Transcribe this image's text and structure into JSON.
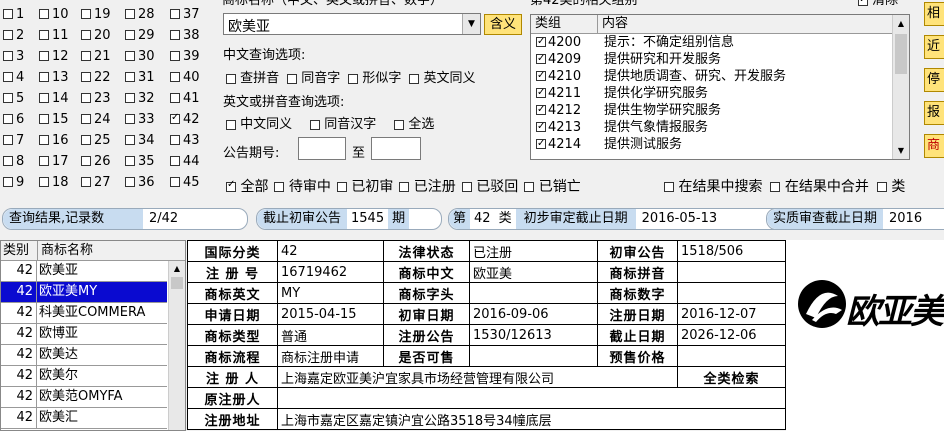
{
  "class_checks": [
    {
      "n": "1",
      "on": false
    },
    {
      "n": "10",
      "on": false
    },
    {
      "n": "19",
      "on": false
    },
    {
      "n": "28",
      "on": false
    },
    {
      "n": "37",
      "on": false
    },
    {
      "n": "2",
      "on": false
    },
    {
      "n": "11",
      "on": false
    },
    {
      "n": "20",
      "on": false
    },
    {
      "n": "29",
      "on": false
    },
    {
      "n": "38",
      "on": false
    },
    {
      "n": "3",
      "on": false
    },
    {
      "n": "12",
      "on": false
    },
    {
      "n": "21",
      "on": false
    },
    {
      "n": "30",
      "on": false
    },
    {
      "n": "39",
      "on": false
    },
    {
      "n": "4",
      "on": false
    },
    {
      "n": "13",
      "on": false
    },
    {
      "n": "22",
      "on": false
    },
    {
      "n": "31",
      "on": false
    },
    {
      "n": "40",
      "on": false
    },
    {
      "n": "5",
      "on": false
    },
    {
      "n": "14",
      "on": false
    },
    {
      "n": "23",
      "on": false
    },
    {
      "n": "32",
      "on": false
    },
    {
      "n": "41",
      "on": false
    },
    {
      "n": "6",
      "on": false
    },
    {
      "n": "15",
      "on": false
    },
    {
      "n": "24",
      "on": false
    },
    {
      "n": "33",
      "on": false
    },
    {
      "n": "42",
      "on": true
    },
    {
      "n": "7",
      "on": false
    },
    {
      "n": "16",
      "on": false
    },
    {
      "n": "25",
      "on": false
    },
    {
      "n": "34",
      "on": false
    },
    {
      "n": "43",
      "on": false
    },
    {
      "n": "8",
      "on": false
    },
    {
      "n": "17",
      "on": false
    },
    {
      "n": "26",
      "on": false
    },
    {
      "n": "35",
      "on": false
    },
    {
      "n": "44",
      "on": false
    },
    {
      "n": "9",
      "on": false
    },
    {
      "n": "18",
      "on": false
    },
    {
      "n": "27",
      "on": false
    },
    {
      "n": "36",
      "on": false
    },
    {
      "n": "45",
      "on": false
    }
  ],
  "search": {
    "title": "商标名称（中文、英文或拼音、数字）",
    "value": "欧美亚",
    "meaning_btn": "含义",
    "cn_options_title": "中文查询选项:",
    "cn_options": [
      "查拼音",
      "同音字",
      "形似字",
      "英文同义"
    ],
    "en_options_title": "英文或拼音查询选项:",
    "en_options": [
      "中文同义",
      "同音汉字",
      "全选"
    ],
    "issue_label": "公告期号:",
    "issue_to": "至"
  },
  "groups": {
    "title": "第42类的相关组别",
    "clear_label": "清除",
    "col_group": "类组",
    "col_content": "内容",
    "rows": [
      {
        "code": "4200",
        "text": "提示：不确定组别信息"
      },
      {
        "code": "4209",
        "text": "提供研究和开发服务"
      },
      {
        "code": "4210",
        "text": "提供地质调查、研究、开发服务"
      },
      {
        "code": "4211",
        "text": "提供化学研究服务"
      },
      {
        "code": "4212",
        "text": "提供生物学研究服务"
      },
      {
        "code": "4213",
        "text": "提供气象情报服务"
      },
      {
        "code": "4214",
        "text": "提供测试服务"
      }
    ]
  },
  "side_buttons": [
    "相",
    "近",
    "停",
    "报",
    "商"
  ],
  "status_filters": [
    {
      "label": "全部",
      "on": true
    },
    {
      "label": "待审中",
      "on": false
    },
    {
      "label": "已初审",
      "on": false
    },
    {
      "label": "已注册",
      "on": false
    },
    {
      "label": "已驳回",
      "on": false
    },
    {
      "label": "已销亡",
      "on": false
    }
  ],
  "result_filters": [
    "在结果中搜索",
    "在结果中合并",
    "类"
  ],
  "info_bar": {
    "result_label": "查询结果,记录数",
    "result_value": "2/42",
    "deadline_label": "截止初审公告",
    "deadline_value": "1545",
    "deadline_unit": "期",
    "class_prefix": "第",
    "class_value": "42",
    "class_suffix": "类",
    "prelim_label": "初步审定截止日期",
    "prelim_value": "2016-05-13",
    "exam_label": "实质审查截止日期",
    "exam_value": "2016"
  },
  "list": {
    "col_class": "类别",
    "col_name": "商标名称",
    "rows": [
      {
        "cls": "42",
        "name": "欧美亚",
        "sel": false
      },
      {
        "cls": "42",
        "name": "欧亚美MY",
        "sel": true
      },
      {
        "cls": "42",
        "name": "科美亚COMMERA",
        "sel": false
      },
      {
        "cls": "42",
        "name": "欧博亚",
        "sel": false
      },
      {
        "cls": "42",
        "name": "欧美达",
        "sel": false
      },
      {
        "cls": "42",
        "name": "欧美尔",
        "sel": false
      },
      {
        "cls": "42",
        "name": "欧美范OMYFA",
        "sel": false
      },
      {
        "cls": "42",
        "name": "欧美汇",
        "sel": false
      }
    ]
  },
  "detail": {
    "intl_class_label": "国际分类",
    "intl_class": "42",
    "legal_status_label": "法律状态",
    "legal_status": "已注册",
    "prelim_notice_label": "初审公告",
    "prelim_notice": "1518/506",
    "reg_no_label": "注 册 号",
    "reg_no": "16719462",
    "cn_label": "商标中文",
    "cn": "欧亚美",
    "pinyin_label": "商标拼音",
    "pinyin": "",
    "en_label": "商标英文",
    "en": "MY",
    "initial_label": "商标字头",
    "initial": "",
    "digit_label": "商标数字",
    "digit": "",
    "apply_date_label": "申请日期",
    "apply_date": "2015-04-15",
    "prelim_date_label": "初审日期",
    "prelim_date": "2016-09-06",
    "reg_date_label": "注册日期",
    "reg_date": "2016-12-07",
    "type_label": "商标类型",
    "type": "普通",
    "reg_notice_label": "注册公告",
    "reg_notice": "1530/12613",
    "expire_label": "截止日期",
    "expire": "2026-12-06",
    "flow_label": "商标流程",
    "flow": "商标注册申请",
    "for_sale_label": "是否可售",
    "for_sale": "",
    "presale_label": "预售价格",
    "presale": "",
    "registrant_label": "注 册 人",
    "registrant": "上海嘉定欧亚美沪宜家具市场经营管理有限公司",
    "full_search": "全类检索",
    "orig_registrant_label": "原注册人",
    "orig_registrant": "",
    "address_label": "注册地址",
    "address": "上海市嘉定区嘉定镇沪宜公路3518号34幢底层"
  },
  "logo_text": "欧亚美"
}
